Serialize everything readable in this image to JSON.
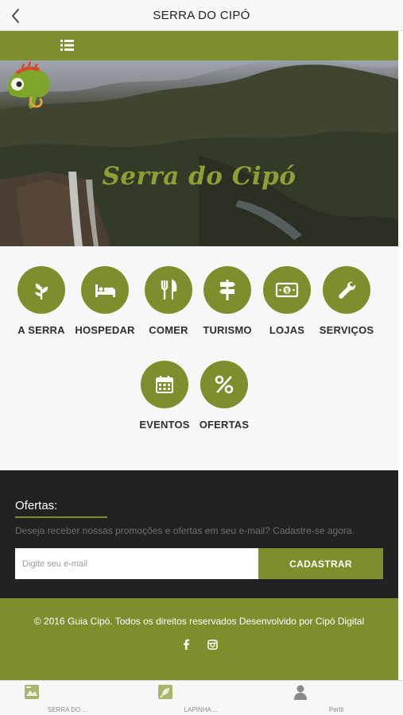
{
  "navbar": {
    "title": "SERRA DO CIPÓ",
    "back_icon": "chevron-left-icon",
    "menu_icon": "list-icon"
  },
  "hero": {
    "brand_title": "Serra do Cipó",
    "logo": "chameleon-logo"
  },
  "categories": [
    {
      "label": "A SERRA",
      "icon": "leaf-icon"
    },
    {
      "label": "HOSPEDAR",
      "icon": "bed-icon"
    },
    {
      "label": "COMER",
      "icon": "fork-knife-icon"
    },
    {
      "label": "TURISMO",
      "icon": "signpost-icon"
    },
    {
      "label": "LOJAS",
      "icon": "money-icon"
    },
    {
      "label": "SERVIÇOS",
      "icon": "wrench-icon"
    },
    {
      "label": "EVENTOS",
      "icon": "calendar-icon"
    },
    {
      "label": "OFERTAS",
      "icon": "percent-icon"
    }
  ],
  "offers": {
    "title": "Ofertas:",
    "description": "Deseja receber nossas promoções e ofertas em seu e-mail? Cadastre-se agora.",
    "email_placeholder": "Digite seu e-mail",
    "email_value": "",
    "submit_label": "CADASTRAR"
  },
  "footer": {
    "copyright": "© 2016 Guia Cipó. Todos os direitos reservados Desenvolvido por Cipó Digital",
    "social": [
      "facebook-icon",
      "instagram-icon"
    ]
  },
  "tabbar": [
    {
      "label": "SERRA DO ...",
      "icon": "serra-tab-icon"
    },
    {
      "label": "LAPINHA ...",
      "icon": "lapinha-tab-icon"
    },
    {
      "label": "Perfil",
      "icon": "person-icon"
    }
  ],
  "colors": {
    "accent": "#7e8e2d",
    "dark": "#222222",
    "background": "#f7f7f7",
    "brand_text": "#8e9f33"
  }
}
